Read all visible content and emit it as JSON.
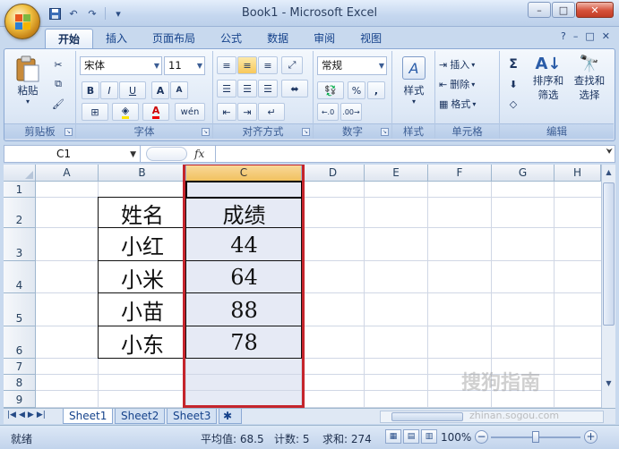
{
  "window": {
    "title": "Book1 - Microsoft Excel"
  },
  "quick_access": {
    "save": "💾",
    "undo": "↶",
    "redo": "↷"
  },
  "window_controls": {
    "minimize": "–",
    "maximize": "□",
    "close": "✕"
  },
  "ribbon_tabs": [
    "开始",
    "插入",
    "页面布局",
    "公式",
    "数据",
    "审阅",
    "视图"
  ],
  "ribbon_right": {
    "help": "?",
    "min": "–",
    "restore": "□",
    "close": "✕"
  },
  "groups": {
    "clipboard": {
      "label": "剪贴板",
      "paste": "粘贴"
    },
    "font": {
      "label": "字体",
      "font_name": "宋体",
      "font_size": "11",
      "bold": "B",
      "italic": "I",
      "underline": "U",
      "grow": "A",
      "shrink": "A",
      "phonetic": "wén"
    },
    "alignment": {
      "label": "对齐方式"
    },
    "number": {
      "label": "数字",
      "format": "常规",
      "percent": "%",
      "comma": ","
    },
    "styles": {
      "label": "样式",
      "styles_btn": "样式"
    },
    "cells": {
      "label": "单元格",
      "insert": "插入",
      "delete": "删除",
      "format": "格式"
    },
    "editing": {
      "label": "编辑",
      "sort": "排序和",
      "filter": "筛选",
      "find": "查找和",
      "select": "选择"
    }
  },
  "formula_bar": {
    "name_box": "C1",
    "fx": "fx",
    "content": ""
  },
  "columns": [
    "A",
    "B",
    "C",
    "D",
    "E",
    "F",
    "G",
    "H"
  ],
  "rows": [
    "1",
    "2",
    "3",
    "4",
    "5",
    "6",
    "7",
    "8",
    "9"
  ],
  "table": {
    "header": [
      "姓名",
      "成绩"
    ],
    "rows": [
      [
        "小红",
        "44"
      ],
      [
        "小米",
        "64"
      ],
      [
        "小苗",
        "88"
      ],
      [
        "小东",
        "78"
      ]
    ]
  },
  "sheets": [
    "Sheet1",
    "Sheet2",
    "Sheet3"
  ],
  "status": {
    "ready": "就绪",
    "average": "平均值: 68.5",
    "count": "计数: 5",
    "sum": "求和: 274",
    "zoom": "100%"
  },
  "watermark": {
    "brand": "搜狗指南",
    "url": "zhinan.sogou.com"
  }
}
